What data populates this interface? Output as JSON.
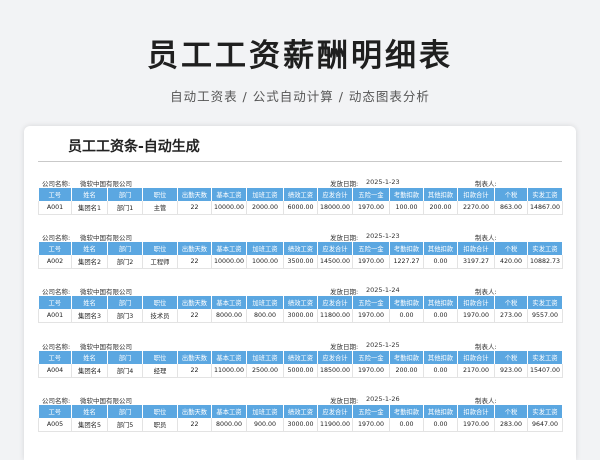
{
  "header": {
    "title": "员工工资薪酬明细表",
    "subtitle": "自动工资表 /  公式自动计算  /  动态图表分析"
  },
  "sheet": {
    "title": "员工工资条-自动生成",
    "company_label": "公司名称:",
    "date_label": "发放日期:",
    "preparer_label": "制表人:",
    "columns": [
      "工号",
      "姓名",
      "部门",
      "职位",
      "出勤天数",
      "基本工资",
      "加班工资",
      "绩效工资",
      "应发合计",
      "五险一金",
      "考勤扣款",
      "其他扣款",
      "扣款合计",
      "个税",
      "实发工资"
    ],
    "slips": [
      {
        "company": "微软中国有限公司",
        "date": "2025-1-23",
        "values": [
          "A001",
          "集团名1",
          "部门1",
          "主管",
          "22",
          "10000.00",
          "2000.00",
          "6000.00",
          "18000.00",
          "1970.00",
          "100.00",
          "200.00",
          "2270.00",
          "863.00",
          "14867.00"
        ]
      },
      {
        "company": "微软中国有限公司",
        "date": "2025-1-23",
        "values": [
          "A002",
          "集团名2",
          "部门2",
          "工程师",
          "22",
          "10000.00",
          "1000.00",
          "3500.00",
          "14500.00",
          "1970.00",
          "1227.27",
          "0.00",
          "3197.27",
          "420.00",
          "10882.73"
        ]
      },
      {
        "company": "微软中国有限公司",
        "date": "2025-1-24",
        "values": [
          "A001",
          "集团名3",
          "部门3",
          "技术员",
          "22",
          "8000.00",
          "800.00",
          "3000.00",
          "11800.00",
          "1970.00",
          "0.00",
          "0.00",
          "1970.00",
          "273.00",
          "9557.00"
        ]
      },
      {
        "company": "微软中国有限公司",
        "date": "2025-1-25",
        "values": [
          "A004",
          "集团名4",
          "部门4",
          "经理",
          "22",
          "11000.00",
          "2500.00",
          "5000.00",
          "18500.00",
          "1970.00",
          "200.00",
          "0.00",
          "2170.00",
          "923.00",
          "15407.00"
        ]
      },
      {
        "company": "微软中国有限公司",
        "date": "2025-1-26",
        "values": [
          "A005",
          "集团名5",
          "部门5",
          "职员",
          "22",
          "8000.00",
          "900.00",
          "3000.00",
          "11900.00",
          "1970.00",
          "0.00",
          "0.00",
          "1970.00",
          "283.00",
          "9647.00"
        ]
      }
    ]
  }
}
